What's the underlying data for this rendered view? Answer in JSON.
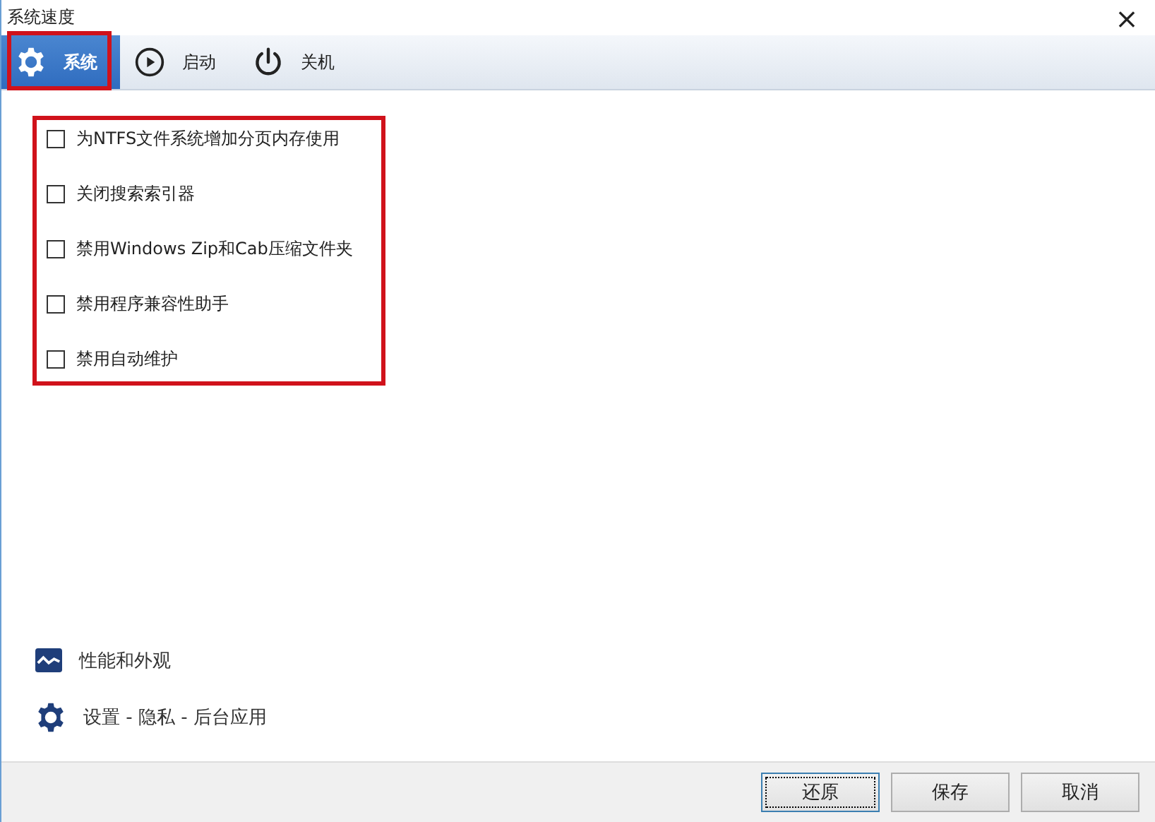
{
  "window": {
    "title": "系统速度",
    "close": "×"
  },
  "tabs": [
    {
      "label": "系统",
      "kind": "gear",
      "selected": true
    },
    {
      "label": "启动",
      "kind": "play",
      "selected": false
    },
    {
      "label": "关机",
      "kind": "power",
      "selected": false
    }
  ],
  "options": [
    {
      "label": "为NTFS文件系统增加分页内存使用",
      "checked": false
    },
    {
      "label": "关闭搜索索引器",
      "checked": false
    },
    {
      "label": "禁用Windows Zip和Cab压缩文件夹",
      "checked": false
    },
    {
      "label": "禁用程序兼容性助手",
      "checked": false
    },
    {
      "label": "禁用自动维护",
      "checked": false
    }
  ],
  "links": [
    {
      "label": "性能和外观",
      "kind": "chart"
    },
    {
      "label": "设置 - 隐私 - 后台应用",
      "kind": "gear"
    }
  ],
  "buttons": [
    {
      "label": "还原",
      "focused": true
    },
    {
      "label": "保存",
      "focused": false
    },
    {
      "label": "取消",
      "focused": false
    }
  ]
}
